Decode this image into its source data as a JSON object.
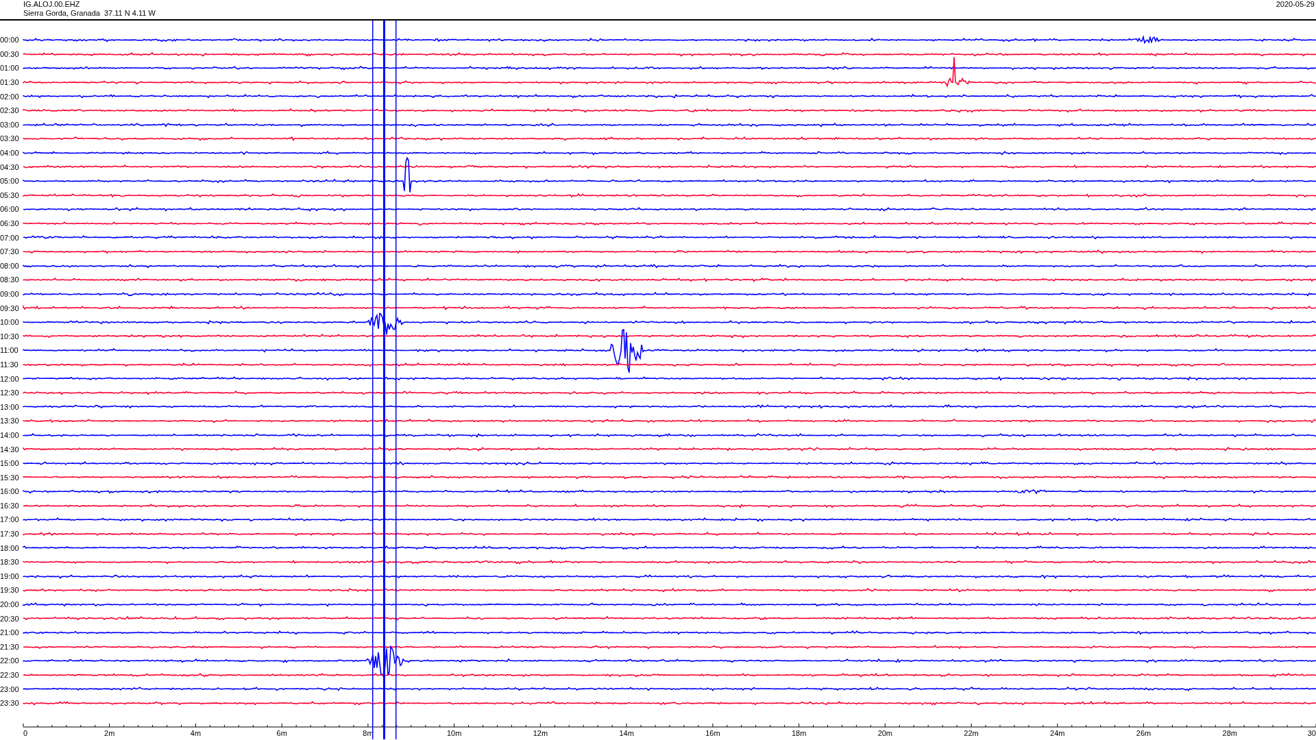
{
  "header": {
    "station": "IG.ALOJ.00.EHZ",
    "location": "Sierra Gorda, Granada  37.11 N 4.11 W",
    "date": "2020-05-29"
  },
  "rows": [
    {
      "label": "00:00",
      "color": "#0000ff"
    },
    {
      "label": "00:30",
      "color": "#ff0033"
    },
    {
      "label": "01:00",
      "color": "#0000ff"
    },
    {
      "label": "01:30",
      "color": "#ff0033"
    },
    {
      "label": "02:00",
      "color": "#0000ff"
    },
    {
      "label": "02:30",
      "color": "#ff0033"
    },
    {
      "label": "03:00",
      "color": "#0000ff"
    },
    {
      "label": "03:30",
      "color": "#ff0033"
    },
    {
      "label": "04:00",
      "color": "#0000ff"
    },
    {
      "label": "04:30",
      "color": "#ff0033"
    },
    {
      "label": "05:00",
      "color": "#0000ff"
    },
    {
      "label": "05:30",
      "color": "#ff0033"
    },
    {
      "label": "06:00",
      "color": "#0000ff"
    },
    {
      "label": "06:30",
      "color": "#ff0033"
    },
    {
      "label": "07:00",
      "color": "#0000ff"
    },
    {
      "label": "07:30",
      "color": "#ff0033"
    },
    {
      "label": "08:00",
      "color": "#0000ff"
    },
    {
      "label": "08:30",
      "color": "#ff0033"
    },
    {
      "label": "09:00",
      "color": "#0000ff"
    },
    {
      "label": "09:30",
      "color": "#ff0033"
    },
    {
      "label": "10:00",
      "color": "#0000ff"
    },
    {
      "label": "10:30",
      "color": "#ff0033"
    },
    {
      "label": "11:00",
      "color": "#0000ff"
    },
    {
      "label": "11:30",
      "color": "#ff0033"
    },
    {
      "label": "12:00",
      "color": "#0000ff"
    },
    {
      "label": "12:30",
      "color": "#ff0033"
    },
    {
      "label": "13:00",
      "color": "#0000ff"
    },
    {
      "label": "13:30",
      "color": "#ff0033"
    },
    {
      "label": "14:00",
      "color": "#0000ff"
    },
    {
      "label": "14:30",
      "color": "#ff0033"
    },
    {
      "label": "15:00",
      "color": "#0000ff"
    },
    {
      "label": "15:30",
      "color": "#ff0033"
    },
    {
      "label": "16:00",
      "color": "#0000ff"
    },
    {
      "label": "16:30",
      "color": "#ff0033"
    },
    {
      "label": "17:00",
      "color": "#0000ff"
    },
    {
      "label": "17:30",
      "color": "#ff0033"
    },
    {
      "label": "18:00",
      "color": "#0000ff"
    },
    {
      "label": "18:30",
      "color": "#ff0033"
    },
    {
      "label": "19:00",
      "color": "#0000ff"
    },
    {
      "label": "19:30",
      "color": "#ff0033"
    },
    {
      "label": "20:00",
      "color": "#0000ff"
    },
    {
      "label": "20:30",
      "color": "#ff0033"
    },
    {
      "label": "21:00",
      "color": "#0000ff"
    },
    {
      "label": "21:30",
      "color": "#ff0033"
    },
    {
      "label": "22:00",
      "color": "#0000ff"
    },
    {
      "label": "22:30",
      "color": "#ff0033"
    },
    {
      "label": "23:00",
      "color": "#0000ff"
    },
    {
      "label": "23:30",
      "color": "#ff0033"
    }
  ],
  "x_axis": {
    "ticks": [
      "0",
      "2m",
      "4m",
      "6m",
      "8m",
      "10m",
      "12m",
      "14m",
      "16m",
      "18m",
      "20m",
      "22m",
      "24m",
      "26m",
      "28m",
      "30"
    ]
  }
}
